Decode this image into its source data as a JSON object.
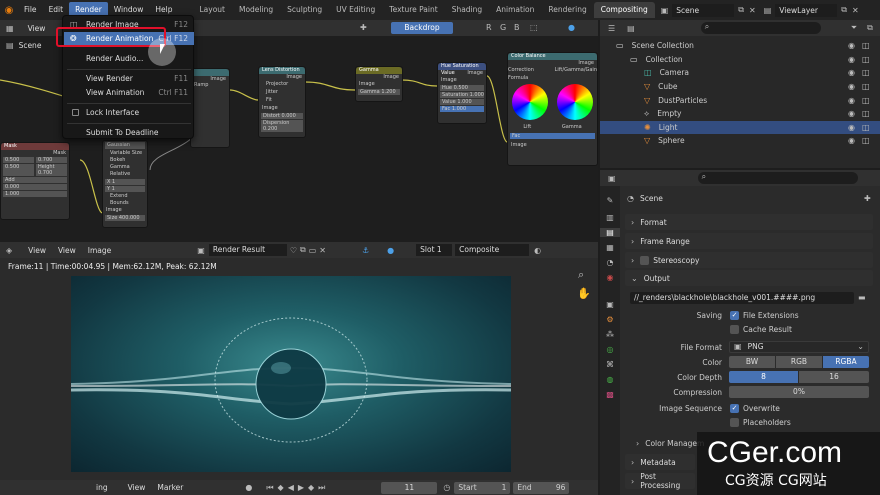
{
  "topbar": {
    "menus": [
      "File",
      "Edit",
      "Render",
      "Window",
      "Help"
    ],
    "active_menu": "Render",
    "workspaces": [
      "Layout",
      "Modeling",
      "Sculpting",
      "UV Editing",
      "Texture Paint",
      "Shading",
      "Animation",
      "Rendering",
      "Compositing"
    ],
    "active_workspace": "Compositing",
    "scene_label": "Scene",
    "viewlayer_label": "ViewLayer"
  },
  "render_menu": {
    "items": [
      {
        "label": "Render Image",
        "shortcut": "F12"
      },
      {
        "label": "Render Animation",
        "shortcut": "Ctrl F12"
      },
      {
        "label": "Render Audio...",
        "shortcut": ""
      },
      {
        "label": "View Render",
        "shortcut": "F11"
      },
      {
        "label": "View Animation",
        "shortcut": "Ctrl F11"
      },
      {
        "label": "Lock Interface",
        "shortcut": ""
      },
      {
        "label": "Submit To Deadline",
        "shortcut": ""
      }
    ]
  },
  "node_editor": {
    "view_label": "View",
    "scene_label": "Scene",
    "backdrop_label": "Backdrop",
    "nodes": {
      "lens": {
        "title": "Lens Distortion",
        "out": "Image",
        "rows": [
          "Projector",
          "Jitter",
          "Fit",
          "Image",
          "Distort 0.000",
          "Dispersion 0.200"
        ]
      },
      "gamma": {
        "title": "Gamma",
        "out": "Image",
        "rows": [
          "Image",
          "Gamma 1.200"
        ]
      },
      "hue": {
        "title": "Hue Saturation Value",
        "out": "Image",
        "rows": [
          "Image",
          "Hue 0.500",
          "Saturation 1.000",
          "Value 1.000",
          "Fac 1.000"
        ]
      },
      "balance": {
        "title": "Color Balance",
        "out": "Image",
        "lift": "Lift",
        "gamma": "Gamma",
        "fac": "Fac",
        "image": "Image",
        "mode": "Lift/Gamma/Gain",
        "method": "Correction Formula"
      },
      "blur": {
        "rows": [
          "Gaussian",
          "Variable Size",
          "Bokeh",
          "Gamma",
          "Relative",
          "X 1",
          "Y 1",
          "Extend Bounds",
          "Image",
          "Size 400.000"
        ]
      },
      "mask": {
        "title": "Mask",
        "rows": [
          "Mask",
          "0.500",
          "0.700",
          "0.500",
          "Height 0.700",
          "Add",
          "0.000",
          "1.000"
        ]
      },
      "image_out": "Image",
      "ramp_label": "Ramp"
    }
  },
  "image_editor": {
    "view_label": "View",
    "view2_label": "View",
    "image_label": "Image",
    "result_label": "Render Result",
    "slot_label": "Slot 1",
    "composite_label": "Composite",
    "info": "Frame:11 | Time:00:04.95 | Mem:62.12M, Peak: 62.12M"
  },
  "timeline": {
    "playing_label": "ing",
    "view_label": "View",
    "marker_label": "Marker",
    "current_frame": "11",
    "start_label": "Start",
    "start_value": "1",
    "end_label": "End",
    "end_value": "96"
  },
  "outliner": {
    "search_placeholder": "",
    "rows": [
      {
        "name": "Scene Collection",
        "indent": 0,
        "selected": false,
        "kind": "collection"
      },
      {
        "name": "Collection",
        "indent": 1,
        "selected": false,
        "kind": "collection"
      },
      {
        "name": "Camera",
        "indent": 2,
        "selected": false,
        "kind": "camera"
      },
      {
        "name": "Cube",
        "indent": 2,
        "selected": false,
        "kind": "mesh"
      },
      {
        "name": "DustParticles",
        "indent": 2,
        "selected": false,
        "kind": "mesh"
      },
      {
        "name": "Empty",
        "indent": 2,
        "selected": false,
        "kind": "empty"
      },
      {
        "name": "Light",
        "indent": 2,
        "selected": true,
        "kind": "light"
      },
      {
        "name": "Sphere",
        "indent": 2,
        "selected": false,
        "kind": "mesh"
      }
    ]
  },
  "properties": {
    "context": "Scene",
    "panels": {
      "format": "Format",
      "frame_range": "Frame Range",
      "stereoscopy": "Stereoscopy",
      "output": "Output",
      "metadata": "Metadata",
      "post_processing": "Post Processing",
      "color_management": "Color Managem"
    },
    "output_path": "//_renders\\blackhole\\blackhole_v001.####.png",
    "saving_label": "Saving",
    "file_extensions": "File Extensions",
    "cache_result": "Cache Result",
    "file_format_label": "File Format",
    "file_format": "PNG",
    "color_label": "Color",
    "color_options": [
      "BW",
      "RGB",
      "RGBA"
    ],
    "color_active": "RGBA",
    "color_depth_label": "Color Depth",
    "color_depth_options": [
      "8",
      "16"
    ],
    "color_depth_active": "8",
    "compression_label": "Compression",
    "compression_value": "0%",
    "image_sequence_label": "Image Sequence",
    "overwrite": "Overwrite",
    "placeholders": "Placeholders"
  },
  "watermark": {
    "line1": "CGer.com",
    "line2": "CG资源 CG网站"
  },
  "colors": {
    "accent": "#4772b3",
    "highlight_box": "#e0102a",
    "selected_row": "#334d80"
  }
}
